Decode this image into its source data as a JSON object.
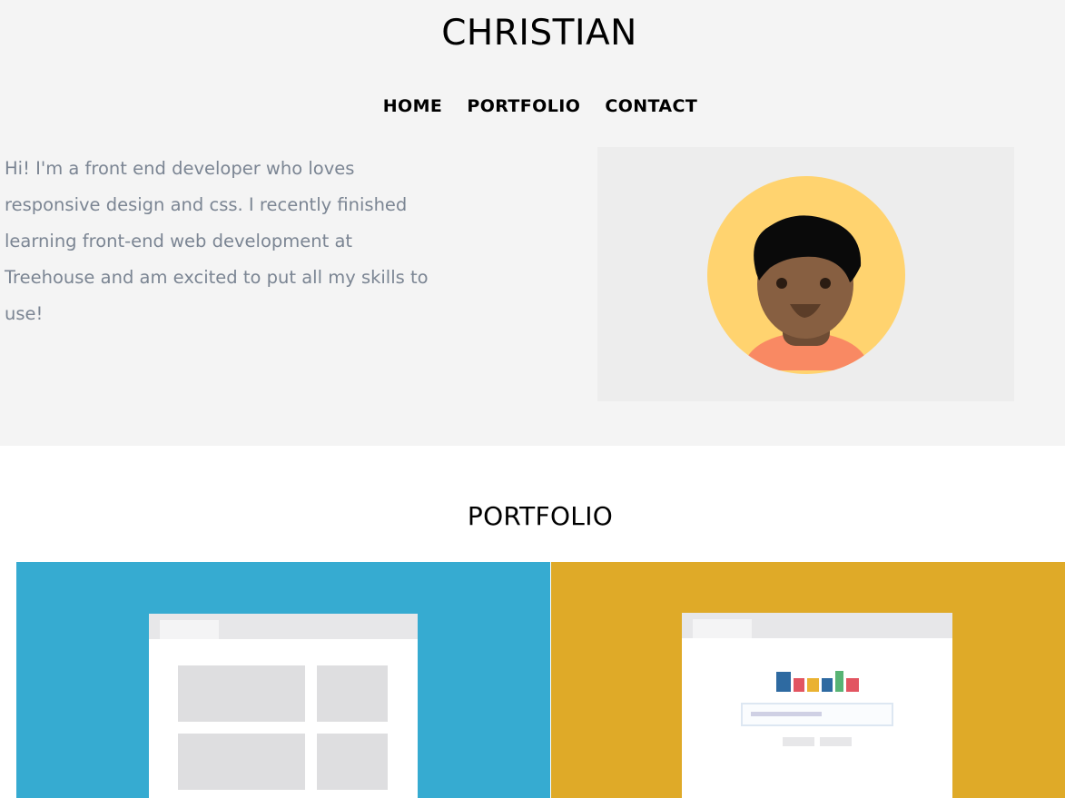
{
  "header": {
    "title": "CHRISTIAN"
  },
  "nav": {
    "items": [
      {
        "label": "HOME"
      },
      {
        "label": "PORTFOLIO"
      },
      {
        "label": "CONTACT"
      }
    ]
  },
  "intro": {
    "text": "Hi! I'm a front end developer who loves responsive design and css. I recently finished learning front-end web development at Treehouse and am excited to put all my skills to use!"
  },
  "portfolio": {
    "heading": "PORTFOLIO"
  },
  "colors": {
    "hero_bg": "#f4f4f4",
    "card_blue": "#36abd1",
    "card_yellow": "#dfaa28",
    "intro_text": "#7b8593",
    "avatar_circle": "#ffd36f",
    "avatar_skin": "#875f41",
    "avatar_shirt": "#f98963"
  },
  "icons": {
    "avatar": "developer-avatar-illustration",
    "portfolio_1": "website-layout-thumbnail",
    "portfolio_2": "dashboard-chart-thumbnail"
  }
}
